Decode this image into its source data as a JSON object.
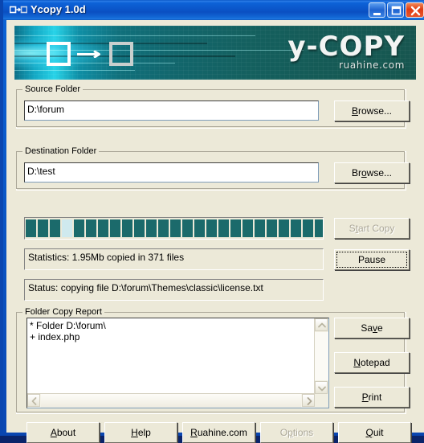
{
  "window": {
    "title": "Ycopy 1.0d",
    "icon": "copy-boxes-icon",
    "minimize_label": "Minimize",
    "maximize_label": "Maximize",
    "close_label": "Close",
    "titlebar_color": "#0b58cc"
  },
  "banner": {
    "logo_text": "y-COPY",
    "logo_sub": "ruahine.com",
    "icon": "copy-boxes-icon",
    "bg_color_left": "#27d3e8",
    "bg_color_right": "#17564f"
  },
  "source": {
    "legend": "Source Folder",
    "value": "D:\\forum",
    "placeholder": "",
    "browse_pre": "",
    "browse_accel": "B",
    "browse_post": "rowse..."
  },
  "destination": {
    "legend": "Destination Folder",
    "value": "D:\\test",
    "placeholder": "",
    "browse_pre": "Br",
    "browse_accel": "o",
    "browse_post": "wse..."
  },
  "progress": {
    "blocks": 25,
    "highlight_index": 3,
    "block_color": "#1b6a6b",
    "highlight_color": "#cfe9ee"
  },
  "statistics": {
    "text": "Statistics: 1.95Mb copied in 371 files",
    "size_copied": "1.95Mb",
    "file_count": "371"
  },
  "status": {
    "text": "Status: copying file D:\\forum\\Themes\\classic\\license.txt",
    "current_file": "D:\\forum\\Themes\\classic\\license.txt"
  },
  "actions": {
    "start_copy": {
      "pre": "S",
      "accel": "t",
      "post": "art Copy",
      "enabled": false
    },
    "pause": {
      "pre": "Pause",
      "accel": "",
      "post": "",
      "focused": true
    }
  },
  "report": {
    "legend": "Folder Copy Report",
    "lines": [
      "* Folder D:\\forum\\",
      "+ index.php"
    ],
    "save": {
      "pre": "Sa",
      "accel": "v",
      "post": "e"
    },
    "notepad": {
      "pre": "",
      "accel": "N",
      "post": "otepad"
    },
    "print": {
      "pre": "",
      "accel": "P",
      "post": "rint"
    }
  },
  "footer": {
    "buttons": [
      {
        "name": "about",
        "pre": "",
        "accel": "A",
        "post": "bout",
        "enabled": true
      },
      {
        "name": "help",
        "pre": "",
        "accel": "H",
        "post": "elp",
        "enabled": true
      },
      {
        "name": "ruahine",
        "pre": "",
        "accel": "R",
        "post": "uahine.com",
        "enabled": true
      },
      {
        "name": "options",
        "pre": "O",
        "accel": "p",
        "post": "tions",
        "enabled": false
      },
      {
        "name": "quit",
        "pre": "",
        "accel": "Q",
        "post": "uit",
        "enabled": true
      }
    ]
  },
  "scrollbars": {
    "vertical_up": "scroll-up-arrow",
    "vertical_down": "scroll-down-arrow",
    "horizontal_left": "scroll-left-arrow",
    "horizontal_right": "scroll-right-arrow"
  }
}
